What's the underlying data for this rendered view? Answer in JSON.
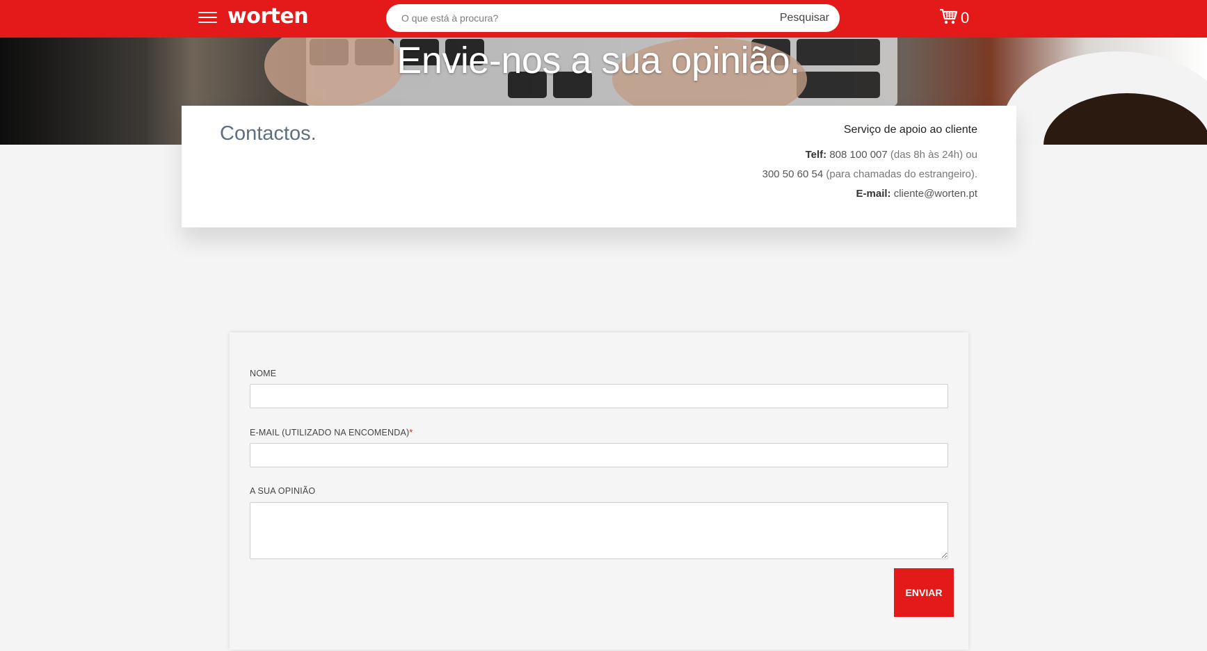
{
  "header": {
    "logo": "worten",
    "search_placeholder": "O que está à procura?",
    "search_button": "Pesquisar",
    "cart_count": "0",
    "brand_color": "#e31a19"
  },
  "hero": {
    "title": "Envie-nos a sua opinião."
  },
  "contacts": {
    "title": "Contactos.",
    "service_title": "Serviço de apoio ao cliente",
    "phone_label": "Telf:",
    "phone": "808 100 007",
    "phone_hours": "(das 8h às 24h) ou",
    "phone_intl": "300 50 60 54",
    "phone_intl_note": "(para chamadas do estrangeiro).",
    "email_label": "E-mail:",
    "email": "cliente@worten.pt"
  },
  "form": {
    "name_label": "NOME",
    "email_label": "E-MAIL (UTILIZADO NA ENCOMENDA)",
    "required_mark": "*",
    "opinion_label": "A SUA OPINIÃO",
    "submit_label": "ENVIAR"
  }
}
